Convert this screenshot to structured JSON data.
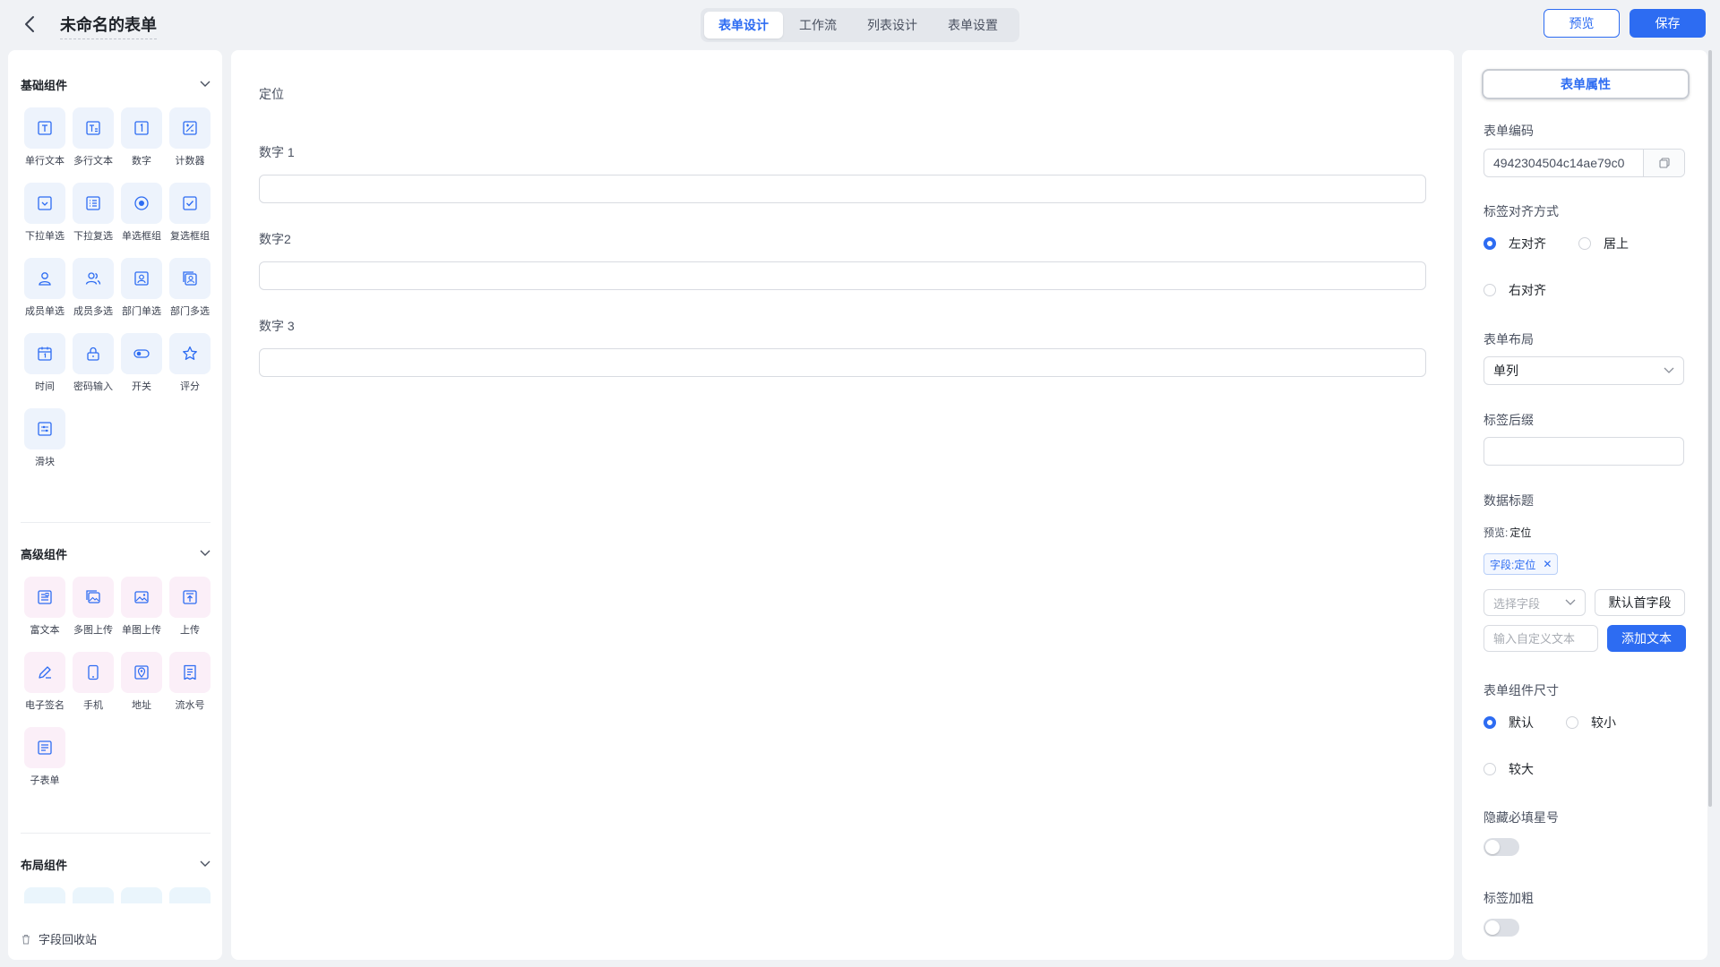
{
  "header": {
    "title": "未命名的表单",
    "tabs": [
      {
        "label": "表单设计",
        "active": true
      },
      {
        "label": "工作流",
        "active": false
      },
      {
        "label": "列表设计",
        "active": false
      },
      {
        "label": "表单设置",
        "active": false
      }
    ],
    "preview_label": "预览",
    "save_label": "保存"
  },
  "left": {
    "basic": {
      "title": "基础组件",
      "items": [
        {
          "label": "单行文本",
          "icon": "single-line-text-icon"
        },
        {
          "label": "多行文本",
          "icon": "multi-line-text-icon"
        },
        {
          "label": "数字",
          "icon": "number-icon"
        },
        {
          "label": "计数器",
          "icon": "counter-icon"
        },
        {
          "label": "下拉单选",
          "icon": "dropdown-single-icon"
        },
        {
          "label": "下拉复选",
          "icon": "dropdown-multi-icon"
        },
        {
          "label": "单选框组",
          "icon": "radio-group-icon"
        },
        {
          "label": "复选框组",
          "icon": "checkbox-group-icon"
        },
        {
          "label": "成员单选",
          "icon": "member-single-icon"
        },
        {
          "label": "成员多选",
          "icon": "member-multi-icon"
        },
        {
          "label": "部门单选",
          "icon": "department-single-icon"
        },
        {
          "label": "部门多选",
          "icon": "department-multi-icon"
        },
        {
          "label": "时间",
          "icon": "calendar-icon"
        },
        {
          "label": "密码输入",
          "icon": "lock-icon"
        },
        {
          "label": "开关",
          "icon": "switch-icon"
        },
        {
          "label": "评分",
          "icon": "star-icon"
        },
        {
          "label": "滑块",
          "icon": "slider-icon"
        }
      ]
    },
    "advanced": {
      "title": "高级组件",
      "items": [
        {
          "label": "富文本",
          "icon": "rich-text-icon"
        },
        {
          "label": "多图上传",
          "icon": "multi-image-upload-icon"
        },
        {
          "label": "单图上传",
          "icon": "single-image-upload-icon"
        },
        {
          "label": "上传",
          "icon": "upload-icon"
        },
        {
          "label": "电子签名",
          "icon": "signature-icon"
        },
        {
          "label": "手机",
          "icon": "phone-icon"
        },
        {
          "label": "地址",
          "icon": "location-icon"
        },
        {
          "label": "流水号",
          "icon": "serial-number-icon"
        },
        {
          "label": "子表单",
          "icon": "sub-form-icon"
        }
      ]
    },
    "layout": {
      "title": "布局组件"
    },
    "recycle_label": "字段回收站"
  },
  "canvas": {
    "fields": [
      {
        "label": "定位",
        "has_input": false
      },
      {
        "label": "数字 1",
        "has_input": true
      },
      {
        "label": "数字2",
        "has_input": true
      },
      {
        "label": "数字 3",
        "has_input": true
      }
    ]
  },
  "props": {
    "tab_label": "表单属性",
    "code_label": "表单编码",
    "code_value": "4942304504c14ae79c0",
    "align_label": "标签对齐方式",
    "align_left": "左对齐",
    "align_top": "居上",
    "align_right": "右对齐",
    "layout_label": "表单布局",
    "layout_value": "单列",
    "suffix_label": "标签后缀",
    "suffix_value": "",
    "data_title_label": "数据标题",
    "preview_prefix": "预览:",
    "preview_value": "定位",
    "tag_text": "字段:定位",
    "select_field_placeholder": "选择字段",
    "default_first_label": "默认首字段",
    "custom_text_placeholder": "输入自定义文本",
    "add_text_label": "添加文本",
    "size_label": "表单组件尺寸",
    "size_default": "默认",
    "size_small": "较小",
    "size_large": "较大",
    "hide_star_label": "隐藏必填星号",
    "bold_label": "标签加粗"
  },
  "colors": {
    "accent": "#2d6cf2",
    "basic_icon_bg": "#edf3fc",
    "advanced_icon_bg": "#fbeff8",
    "layout_icon_bg": "#eaf5fc"
  }
}
